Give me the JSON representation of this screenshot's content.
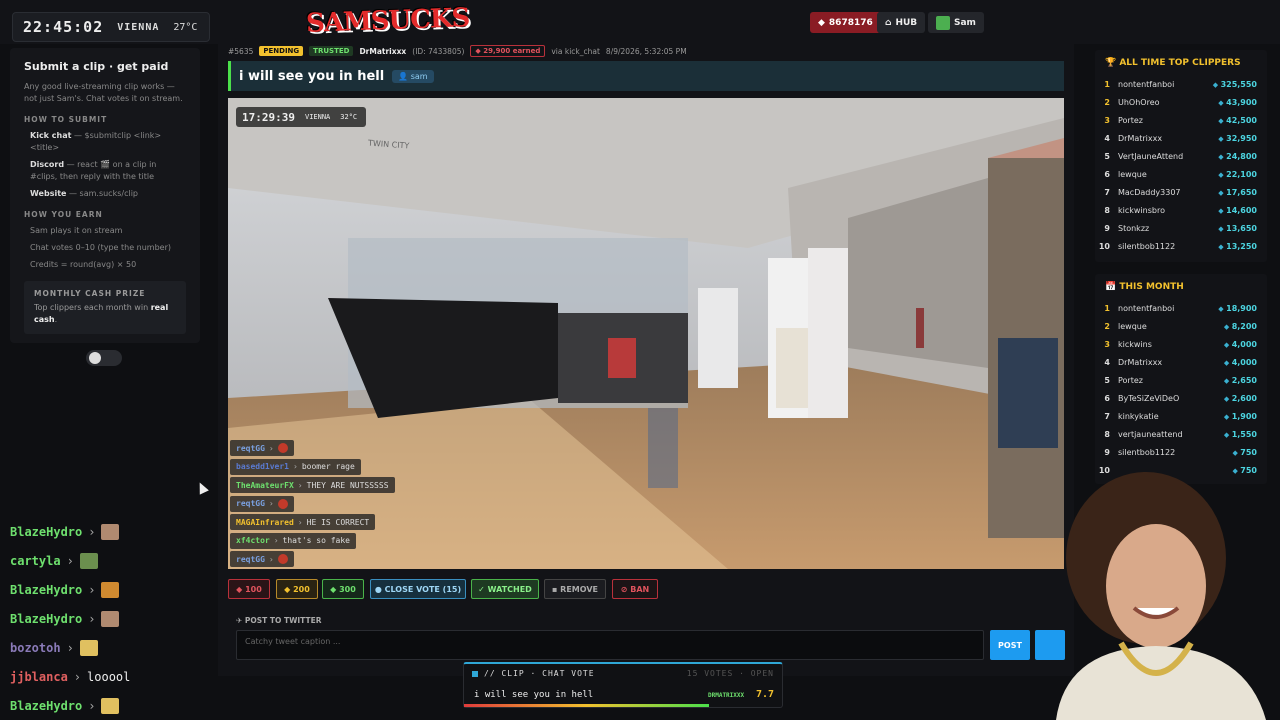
{
  "topbar": {
    "time": "22:45:02",
    "city": "VIENNA",
    "temp": "27°C",
    "logo": "SAMSUCKS",
    "gems": "8678176",
    "hub_label": "HUB",
    "user_label": "Sam"
  },
  "sidebar": {
    "title": "Submit a clip · get paid",
    "intro": "Any good live-streaming clip works — not just Sam's. Chat votes it on stream.",
    "how_submit_head": "HOW TO SUBMIT",
    "submit_items": [
      {
        "label": "Kick chat",
        "text": " — $submitclip <link> <title>"
      },
      {
        "label": "Discord",
        "text": " — react 🎬 on a clip in #clips, then reply with the title"
      },
      {
        "label": "Website",
        "text": " — sam.sucks/clip"
      }
    ],
    "how_earn_head": "HOW YOU EARN",
    "earn_items": [
      "Sam plays it on stream",
      "Chat votes 0–10 (type the number)",
      "Credits = round(avg) × 50"
    ],
    "prize_head": "MONTHLY CASH PRIZE",
    "prize_text_a": "Top clippers each month win ",
    "prize_text_b": "real cash",
    "prize_text_c": "."
  },
  "left_chat": [
    {
      "name": "BlazeHydro",
      "color": "#6ee06e",
      "msg": "",
      "emote": "#b08a70"
    },
    {
      "name": "cartyla",
      "color": "#6ee06e",
      "msg": "",
      "emote": "#6b8f4e"
    },
    {
      "name": "BlazeHydro",
      "color": "#6ee06e",
      "msg": "",
      "emote": "#d08a30"
    },
    {
      "name": "BlazeHydro",
      "color": "#6ee06e",
      "msg": "",
      "emote": "#b08a70"
    },
    {
      "name": "bozotoh",
      "color": "#8a7ab8",
      "msg": "",
      "emote": "#e0c060"
    },
    {
      "name": "jjblanca",
      "color": "#e06060",
      "msg": "looool",
      "emote": ""
    },
    {
      "name": "BlazeHydro",
      "color": "#6ee06e",
      "msg": "",
      "emote": "#e0c060"
    }
  ],
  "clip": {
    "id": "#5635",
    "status": "PENDING",
    "trust": "TRUSTED",
    "user": "DrMatrixxx",
    "user_id": "(ID: 7433805)",
    "earned": "◆ 29,900 earned",
    "via": "via kick_chat",
    "date": "8/9/2026, 5:32:05 PM",
    "title": "i will see you in hell",
    "tag": "sam"
  },
  "video": {
    "time": "17:29:39",
    "city": "VIENNA",
    "temp": "32°C",
    "sign": "TWIN CITY",
    "chat": [
      {
        "name": "reqtGG",
        "color": "#7aa0e0",
        "msg": "",
        "emote": true
      },
      {
        "name": "basedd1ver1",
        "color": "#5a7ad0",
        "msg": "boomer rage",
        "emote": false
      },
      {
        "name": "TheAmateurFX",
        "color": "#6ee06e",
        "msg": "THEY ARE NUTSSSSS",
        "emote": false
      },
      {
        "name": "reqtGG",
        "color": "#7aa0e0",
        "msg": "",
        "emote": true
      },
      {
        "name": "MAGAInfrared",
        "color": "#f2c12e",
        "msg": "HE IS CORRECT",
        "emote": false
      },
      {
        "name": "xf4ctor",
        "color": "#6ee06e",
        "msg": "that's so fake",
        "emote": false
      },
      {
        "name": "reqtGG",
        "color": "#7aa0e0",
        "msg": "",
        "emote": true
      }
    ]
  },
  "actions": {
    "v100": "◆ 100",
    "v200": "◆ 200",
    "v300": "◆ 300",
    "close_vote": "● CLOSE VOTE (15)",
    "watched": "✓ WATCHED",
    "remove": "▪ REMOVE",
    "ban": "⊘ BAN"
  },
  "twitter": {
    "head": "✈ POST TO TWITTER",
    "placeholder": "Catchy tweet caption ...",
    "post": "POST"
  },
  "vote": {
    "label": "// CLIP · CHAT VOTE",
    "votes": "15 VOTES · OPEN",
    "title": "i will see you in hell",
    "user": "DRMATRIXXX",
    "score": "7.7",
    "progress": 0.77
  },
  "leaderboard_all": {
    "head": "🏆 ALL TIME TOP CLIPPERS",
    "rows": [
      {
        "rank": "1",
        "name": "nontentfanboi",
        "score": "325,550"
      },
      {
        "rank": "2",
        "name": "UhOhOreo",
        "score": "43,900"
      },
      {
        "rank": "3",
        "name": "Portez",
        "score": "42,500"
      },
      {
        "rank": "4",
        "name": "DrMatrixxx",
        "score": "32,950"
      },
      {
        "rank": "5",
        "name": "VertJauneAttend",
        "score": "24,800"
      },
      {
        "rank": "6",
        "name": "lewque",
        "score": "22,100"
      },
      {
        "rank": "7",
        "name": "MacDaddy3307",
        "score": "17,650"
      },
      {
        "rank": "8",
        "name": "kickwinsbro",
        "score": "14,600"
      },
      {
        "rank": "9",
        "name": "Stonkzz",
        "score": "13,650"
      },
      {
        "rank": "10",
        "name": "silentbob1122",
        "score": "13,250"
      }
    ]
  },
  "leaderboard_month": {
    "head": "📅 THIS MONTH",
    "rows": [
      {
        "rank": "1",
        "name": "nontentfanboi",
        "score": "18,900"
      },
      {
        "rank": "2",
        "name": "lewque",
        "score": "8,200"
      },
      {
        "rank": "3",
        "name": "kickwins",
        "score": "4,000"
      },
      {
        "rank": "4",
        "name": "DrMatrixxx",
        "score": "4,000"
      },
      {
        "rank": "5",
        "name": "Portez",
        "score": "2,650"
      },
      {
        "rank": "6",
        "name": "ByTeSiZeViDeO",
        "score": "2,600"
      },
      {
        "rank": "7",
        "name": "kinkykatie",
        "score": "1,900"
      },
      {
        "rank": "8",
        "name": "vertjauneattend",
        "score": "1,550"
      },
      {
        "rank": "9",
        "name": "silentbob1122",
        "score": "750"
      },
      {
        "rank": "10",
        "name": "",
        "score": "750"
      }
    ]
  }
}
